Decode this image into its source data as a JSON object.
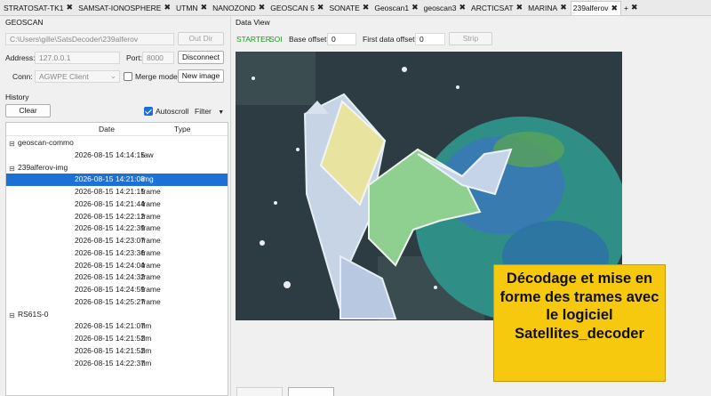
{
  "tabs": [
    {
      "label": "STRATOSAT-TK1",
      "active": false
    },
    {
      "label": "SAMSAT-IONOSPHERE",
      "active": false
    },
    {
      "label": "UTMN",
      "active": false
    },
    {
      "label": "NANOZOND",
      "active": false
    },
    {
      "label": "GEOSCAN 5",
      "active": false
    },
    {
      "label": "SONATE",
      "active": false
    },
    {
      "label": "Geoscan1",
      "active": false
    },
    {
      "label": "geoscan3",
      "active": false
    },
    {
      "label": "ARCTICSAT",
      "active": false
    },
    {
      "label": "MARINA",
      "active": false
    },
    {
      "label": "239alferov",
      "active": true
    }
  ],
  "add_tab_label": "+",
  "left": {
    "group_title": "GEOSCAN",
    "out_path": "C:\\Users\\gille\\SatsDecoder\\239alferov",
    "out_dir_button": "Out Dir",
    "address_label": "Address:",
    "address_value": "127.0.0.1",
    "port_label": "Port:",
    "port_value": "8000",
    "disconnect_button": "Disconnect",
    "conn_label": "Conn:",
    "conn_value": "AGWPE Client",
    "merge_mode_label": "Merge mode",
    "merge_mode_checked": false,
    "new_image_button": "New image",
    "history_label": "History",
    "clear_button": "Clear",
    "autoscroll_label": "Autoscroll",
    "autoscroll_checked": true,
    "filter_label": "Filter",
    "columns": {
      "date": "Date",
      "type": "Type"
    },
    "groups": [
      {
        "name": "geoscan-commo",
        "rows": [
          {
            "date": "2026-08-15 14:14:15",
            "type": "raw",
            "selected": false
          }
        ]
      },
      {
        "name": "239alferov-img",
        "rows": [
          {
            "date": "2026-08-15 14:21:08",
            "type": "img",
            "selected": true
          },
          {
            "date": "2026-08-15 14:21:15",
            "type": "frame",
            "selected": false
          },
          {
            "date": "2026-08-15 14:21:44",
            "type": "frame",
            "selected": false
          },
          {
            "date": "2026-08-15 14:22:12",
            "type": "frame",
            "selected": false
          },
          {
            "date": "2026-08-15 14:22:39",
            "type": "frame",
            "selected": false
          },
          {
            "date": "2026-08-15 14:23:07",
            "type": "frame",
            "selected": false
          },
          {
            "date": "2026-08-15 14:23:36",
            "type": "frame",
            "selected": false
          },
          {
            "date": "2026-08-15 14:24:04",
            "type": "frame",
            "selected": false
          },
          {
            "date": "2026-08-15 14:24:32",
            "type": "frame",
            "selected": false
          },
          {
            "date": "2026-08-15 14:24:59",
            "type": "frame",
            "selected": false
          },
          {
            "date": "2026-08-15 14:25:27",
            "type": "frame",
            "selected": false
          }
        ]
      },
      {
        "name": "RS61S-0",
        "rows": [
          {
            "date": "2026-08-15 14:21:07",
            "type": "tlm",
            "selected": false
          },
          {
            "date": "2026-08-15 14:21:52",
            "type": "tlm",
            "selected": false
          },
          {
            "date": "2026-08-15 14:21:52",
            "type": "tlm",
            "selected": false
          },
          {
            "date": "2026-08-15 14:22:37",
            "type": "tlm",
            "selected": false
          }
        ]
      }
    ]
  },
  "right": {
    "group_title": "Data View",
    "starter_label": "STARTER",
    "soi_label": "SOI",
    "base_offset_label": "Base offset:",
    "base_offset_value": "0",
    "first_offset_label": "First data offset:",
    "first_offset_value": "0",
    "strip_button": "Strip",
    "callout_text": "Décodage et mise en forme des trames avec le logiciel Satellites_decoder"
  },
  "colors": {
    "accent": "#1c70d6",
    "starter_green": "#1a9a1a",
    "callout_bg": "#f6c90e"
  }
}
